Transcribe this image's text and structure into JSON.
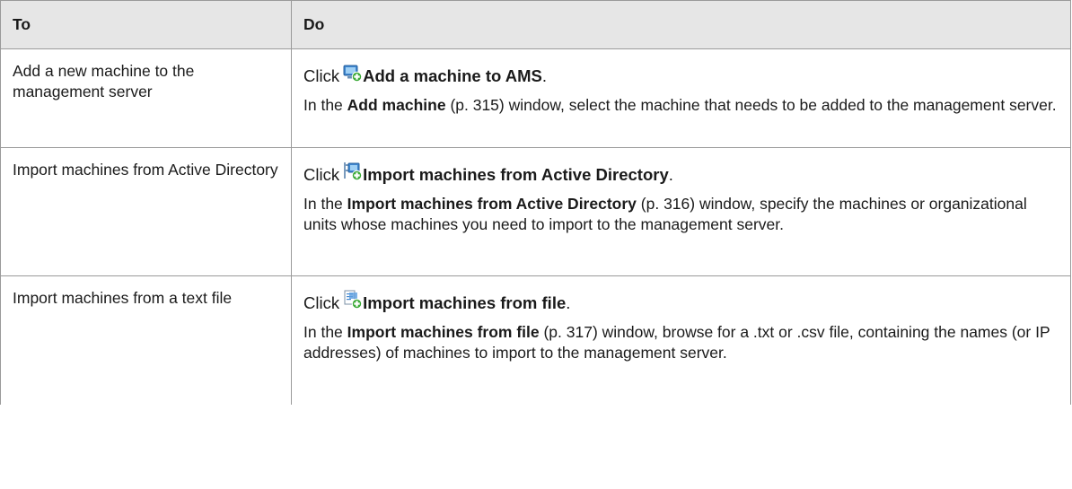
{
  "header": {
    "col_to": "To",
    "col_do": "Do"
  },
  "rows": [
    {
      "to": "Add a new machine to the management server",
      "click": "Click",
      "icon": "add-machine-icon",
      "action": "Add a machine to AMS",
      "period": ".",
      "desc_pre": "In the",
      "desc_bold": "Add machine",
      "desc_post": "(p. 315) window, select the machine that needs to be added to the management server."
    },
    {
      "to": "Import machines from Active Directory",
      "click": "Click",
      "icon": "import-ad-icon",
      "action": "Import machines from Active Directory",
      "period": ".",
      "desc_pre": "In the",
      "desc_bold": "Import machines from Active Directory",
      "desc_post": "(p. 316) window, specify the machines or organizational units whose machines you need to import to the management server."
    },
    {
      "to": "Import machines from a text file",
      "click": "Click",
      "icon": "import-file-icon",
      "action": "Import machines from file",
      "period": ".",
      "desc_pre": "In the",
      "desc_bold": "Import machines from file",
      "desc_post": "(p. 317) window, browse for a .txt or .csv file, containing the names (or IP addresses) of machines to import to the management server."
    }
  ],
  "colors": {
    "header_bg": "#e6e6e6",
    "border": "#9a9a9a",
    "icon_blue": "#3f86cf",
    "icon_green": "#39a935"
  }
}
